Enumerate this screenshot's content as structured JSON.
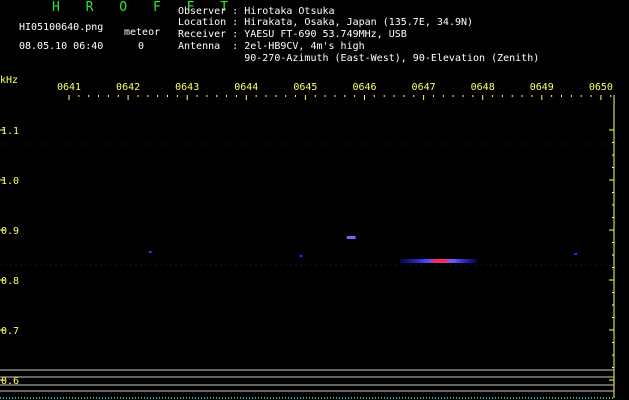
{
  "header": {
    "app_title": "H R O F F T",
    "filename": "HI05100640.png",
    "datetime": "08.05.10 06:40",
    "meteor_label": "meteor",
    "meteor_count": "0",
    "observer": "Observer : Hirotaka Otsuka",
    "location": "Location : Hirakata, Osaka, Japan (135.7E, 34.9N)",
    "receiver": "Receiver : YAESU FT-690 53.749MHz, USB",
    "antenna": "Antenna  : 2el-HB9CV, 4m's high",
    "antenna_detail": "           90-270-Azimuth (East-West), 90-Elevation (Zenith)"
  },
  "chart_data": {
    "type": "heatmap",
    "ylabel": "kHz",
    "x_ticks": [
      "0641",
      "0642",
      "0643",
      "0644",
      "0645",
      "0646",
      "0647",
      "0648",
      "0649",
      "0650"
    ],
    "y_ticks": [
      "1.1",
      "1.0",
      "0.9",
      "0.8",
      "0.7",
      "0.6"
    ],
    "ylim": [
      0.58,
      1.1
    ],
    "colors": {
      "axis": "#ffff66",
      "background": "#000000",
      "signal_low": "#1a1aff",
      "signal_high": "#ff3366"
    },
    "signals": [
      {
        "x_start": "0646.60",
        "x_end": "0647.90",
        "y": 0.838,
        "intensity": "high"
      },
      {
        "x_start": "0645.70",
        "x_end": "0645.85",
        "y": 0.885,
        "intensity": "medium"
      },
      {
        "x_start": "0642.35",
        "x_end": "0642.40",
        "y": 0.856,
        "intensity": "low"
      },
      {
        "x_start": "0644.90",
        "x_end": "0644.95",
        "y": 0.848,
        "intensity": "low"
      },
      {
        "x_start": "0649.55",
        "x_end": "0649.60",
        "y": 0.852,
        "intensity": "low"
      }
    ]
  }
}
